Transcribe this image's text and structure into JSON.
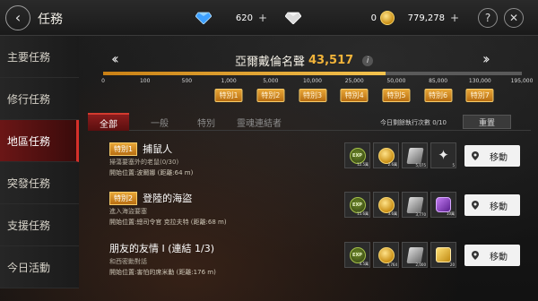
{
  "header": {
    "title": "任務",
    "currency": [
      {
        "name": "diamond",
        "value": "620",
        "plus": "+"
      },
      {
        "name": "silver-gem",
        "value": "0",
        "plus": "+"
      },
      {
        "name": "gold",
        "value": "779,278",
        "plus": "+"
      }
    ],
    "help": "?",
    "close": "✕"
  },
  "sidebar": {
    "items": [
      {
        "label": "主要任務",
        "active": false
      },
      {
        "label": "修行任務",
        "active": false
      },
      {
        "label": "地區任務",
        "active": true
      },
      {
        "label": "突發任務",
        "active": false
      },
      {
        "label": "支援任務",
        "active": false
      },
      {
        "label": "今日活動",
        "active": false
      }
    ]
  },
  "reputation": {
    "title": "亞爾戴倫名聲",
    "score": "43,517",
    "info": "i",
    "progress_value": 43517,
    "ticks": [
      "0",
      "100",
      "500",
      "1,000",
      "5,000",
      "10,000",
      "25,000",
      "50,000",
      "85,000",
      "130,000",
      "195,000"
    ],
    "badges": [
      "特別1",
      "特別2",
      "特別3",
      "特別4",
      "特別5",
      "特別6",
      "特別7"
    ]
  },
  "tabs": [
    "全部",
    "一般",
    "特別",
    "靈魂連結者"
  ],
  "exec_count": "今日剩餘執行次數 0/10",
  "reset_label": "重置",
  "quests": [
    {
      "tag": "特別1",
      "name": "捕鼠人",
      "desc": "掃蕩要塞外的老鼠(0/30)",
      "start": "開始位置:波爾娜 (距離:64 m)",
      "rewards": [
        {
          "icon": "exp-icon",
          "amount": "12.5萬"
        },
        {
          "icon": "coin-icon",
          "amount": "2.6萬"
        },
        {
          "icon": "book-icon",
          "amount": "5,075"
        },
        {
          "icon": "star-icon",
          "amount": "5"
        }
      ],
      "move_label": "移動"
    },
    {
      "tag": "特別2",
      "name": "登陸的海盜",
      "desc": "進入海盜要塞",
      "start": "開始位置:總司令官 克拉夫特 (距離:68 m)",
      "rewards": [
        {
          "icon": "exp-icon",
          "amount": "15.6萬"
        },
        {
          "icon": "coin-icon",
          "amount": "3.6萬"
        },
        {
          "icon": "book-icon",
          "amount": "3,770"
        },
        {
          "icon": "purple-icon",
          "amount": "10萬"
        }
      ],
      "move_label": "移動"
    },
    {
      "tag": "",
      "name": "朋友的友情 I (連結 1/3)",
      "desc": "和西密勳對話",
      "start": "開始位置:害怕的席米勳 (距離:176 m)",
      "rewards": [
        {
          "icon": "exp-icon",
          "amount": "4.5萬"
        },
        {
          "icon": "coin-icon",
          "amount": "3,764"
        },
        {
          "icon": "book-icon",
          "amount": "2,000"
        },
        {
          "icon": "yellow-icon",
          "amount": "20"
        }
      ],
      "move_label": "移動"
    }
  ],
  "colors": {
    "accent_red": "#d6302a",
    "gold": "#f2b43a"
  }
}
